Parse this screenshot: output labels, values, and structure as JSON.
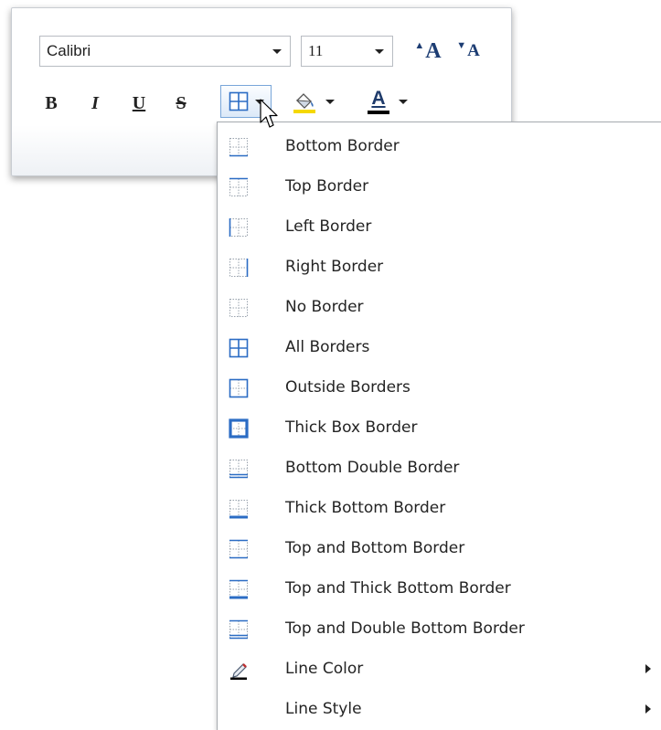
{
  "ribbon": {
    "font_name": "Calibri",
    "font_size": "11",
    "grow_font_label": "A",
    "shrink_font_label": "A",
    "bold_label": "B",
    "italic_label": "I",
    "underline_label": "U",
    "strike_label": "S",
    "font_color_label": "A",
    "fill_color": "#f5d800",
    "font_color": "#000000",
    "icons": [
      "chevron-down-icon",
      "all-borders-icon",
      "paint-bucket-icon",
      "font-color-icon"
    ]
  },
  "menu": {
    "items": [
      {
        "label": "Bottom Border",
        "icon": "bottom-border-icon"
      },
      {
        "label": "Top Border",
        "icon": "top-border-icon"
      },
      {
        "label": "Left Border",
        "icon": "left-border-icon"
      },
      {
        "label": "Right Border",
        "icon": "right-border-icon"
      },
      {
        "label": "No Border",
        "icon": "no-border-icon"
      },
      {
        "label": "All Borders",
        "icon": "all-borders-icon"
      },
      {
        "label": "Outside Borders",
        "icon": "outside-borders-icon"
      },
      {
        "label": "Thick Box Border",
        "icon": "thick-box-border-icon"
      },
      {
        "label": "Bottom Double Border",
        "icon": "bottom-double-border-icon"
      },
      {
        "label": "Thick Bottom Border",
        "icon": "thick-bottom-border-icon"
      },
      {
        "label": "Top and Bottom Border",
        "icon": "top-bottom-border-icon"
      },
      {
        "label": "Top and Thick Bottom Border",
        "icon": "top-thick-bottom-border-icon"
      },
      {
        "label": "Top and Double Bottom Border",
        "icon": "top-double-bottom-border-icon"
      },
      {
        "label": "Line Color",
        "icon": "pencil-icon"
      },
      {
        "label": "Line Style",
        "icon": ""
      }
    ],
    "accent_color": "#2b6cc4"
  }
}
